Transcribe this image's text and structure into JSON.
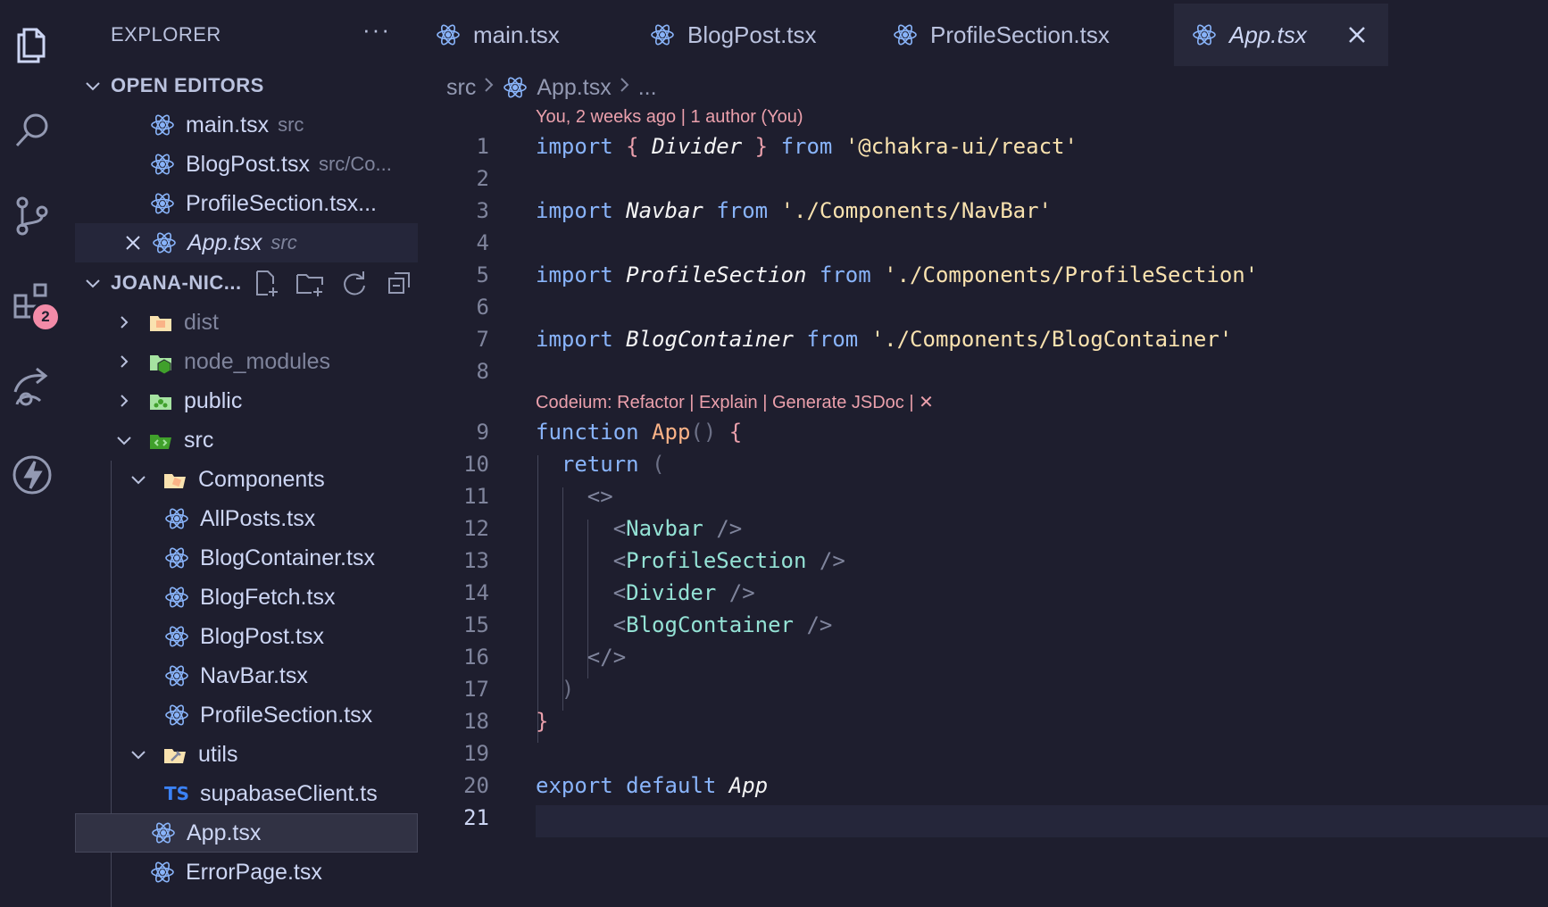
{
  "activity_bar": {
    "icons": [
      "explorer-icon",
      "search-icon",
      "source-control-icon",
      "extensions-icon",
      "remote-icon",
      "lightning-icon"
    ],
    "extensions_badge": "2"
  },
  "sidebar": {
    "title": "EXPLORER",
    "more": "···",
    "open_editors": {
      "header": "OPEN EDITORS",
      "items": [
        {
          "name": "main.tsx",
          "desc": "src"
        },
        {
          "name": "BlogPost.tsx",
          "desc": "src/Co..."
        },
        {
          "name": "ProfileSection.tsx...",
          "desc": ""
        },
        {
          "name": "App.tsx",
          "desc": "src"
        }
      ]
    },
    "project": {
      "header": "JOANA-NIC...",
      "tree": [
        {
          "name": "dist"
        },
        {
          "name": "node_modules"
        },
        {
          "name": "public"
        },
        {
          "name": "src"
        },
        {
          "name": "Components"
        },
        {
          "name": "AllPosts.tsx"
        },
        {
          "name": "BlogContainer.tsx"
        },
        {
          "name": "BlogFetch.tsx"
        },
        {
          "name": "BlogPost.tsx"
        },
        {
          "name": "NavBar.tsx"
        },
        {
          "name": "ProfileSection.tsx"
        },
        {
          "name": "utils"
        },
        {
          "name": "supabaseClient.ts",
          "badge": "TS"
        },
        {
          "name": "App.tsx"
        },
        {
          "name": "ErrorPage.tsx"
        }
      ]
    }
  },
  "tabs": [
    {
      "label": "main.tsx"
    },
    {
      "label": "BlogPost.tsx"
    },
    {
      "label": "ProfileSection.tsx"
    },
    {
      "label": "App.tsx",
      "active": true
    }
  ],
  "breadcrumb": {
    "folder": "src",
    "file": "App.tsx",
    "more": "..."
  },
  "editor": {
    "blame": "You, 2 weeks ago | 1 author (You)",
    "codelens": "Codeium: Refactor | Explain | Generate JSDoc | ✕",
    "line_numbers": [
      "1",
      "2",
      "3",
      "4",
      "5",
      "6",
      "7",
      "8",
      "9",
      "10",
      "11",
      "12",
      "13",
      "14",
      "15",
      "16",
      "17",
      "18",
      "19",
      "20",
      "21"
    ],
    "current_line": "21",
    "code": {
      "l1": {
        "kw1": "import",
        "b1": "{",
        "id": "Divider",
        "b2": "}",
        "kw2": "from",
        "str": "'@chakra-ui/react'"
      },
      "l3": {
        "kw1": "import",
        "id": "Navbar",
        "kw2": "from",
        "str": "'./Components/NavBar'"
      },
      "l5": {
        "kw1": "import",
        "id": "ProfileSection",
        "kw2": "from",
        "str": "'./Components/ProfileSection'"
      },
      "l7": {
        "kw1": "import",
        "id": "BlogContainer",
        "kw2": "from",
        "str": "'./Components/BlogContainer'"
      },
      "l9": {
        "kw": "function",
        "name": "App",
        "parens": "()",
        "brace": "{"
      },
      "l10": {
        "kw": "return",
        "paren": "("
      },
      "l11": {
        "frag": "<>"
      },
      "l12": {
        "lt": "<",
        "tag": "Navbar",
        "end": "/>"
      },
      "l13": {
        "lt": "<",
        "tag": "ProfileSection",
        "end": "/>"
      },
      "l14": {
        "lt": "<",
        "tag": "Divider",
        "end": "/>"
      },
      "l15": {
        "lt": "<",
        "tag": "BlogContainer",
        "end": "/>"
      },
      "l16": {
        "frag": "</>"
      },
      "l17": {
        "paren": ")"
      },
      "l18": {
        "brace": "}"
      },
      "l20": {
        "kw1": "export",
        "kw2": "default",
        "id": "App"
      }
    }
  }
}
